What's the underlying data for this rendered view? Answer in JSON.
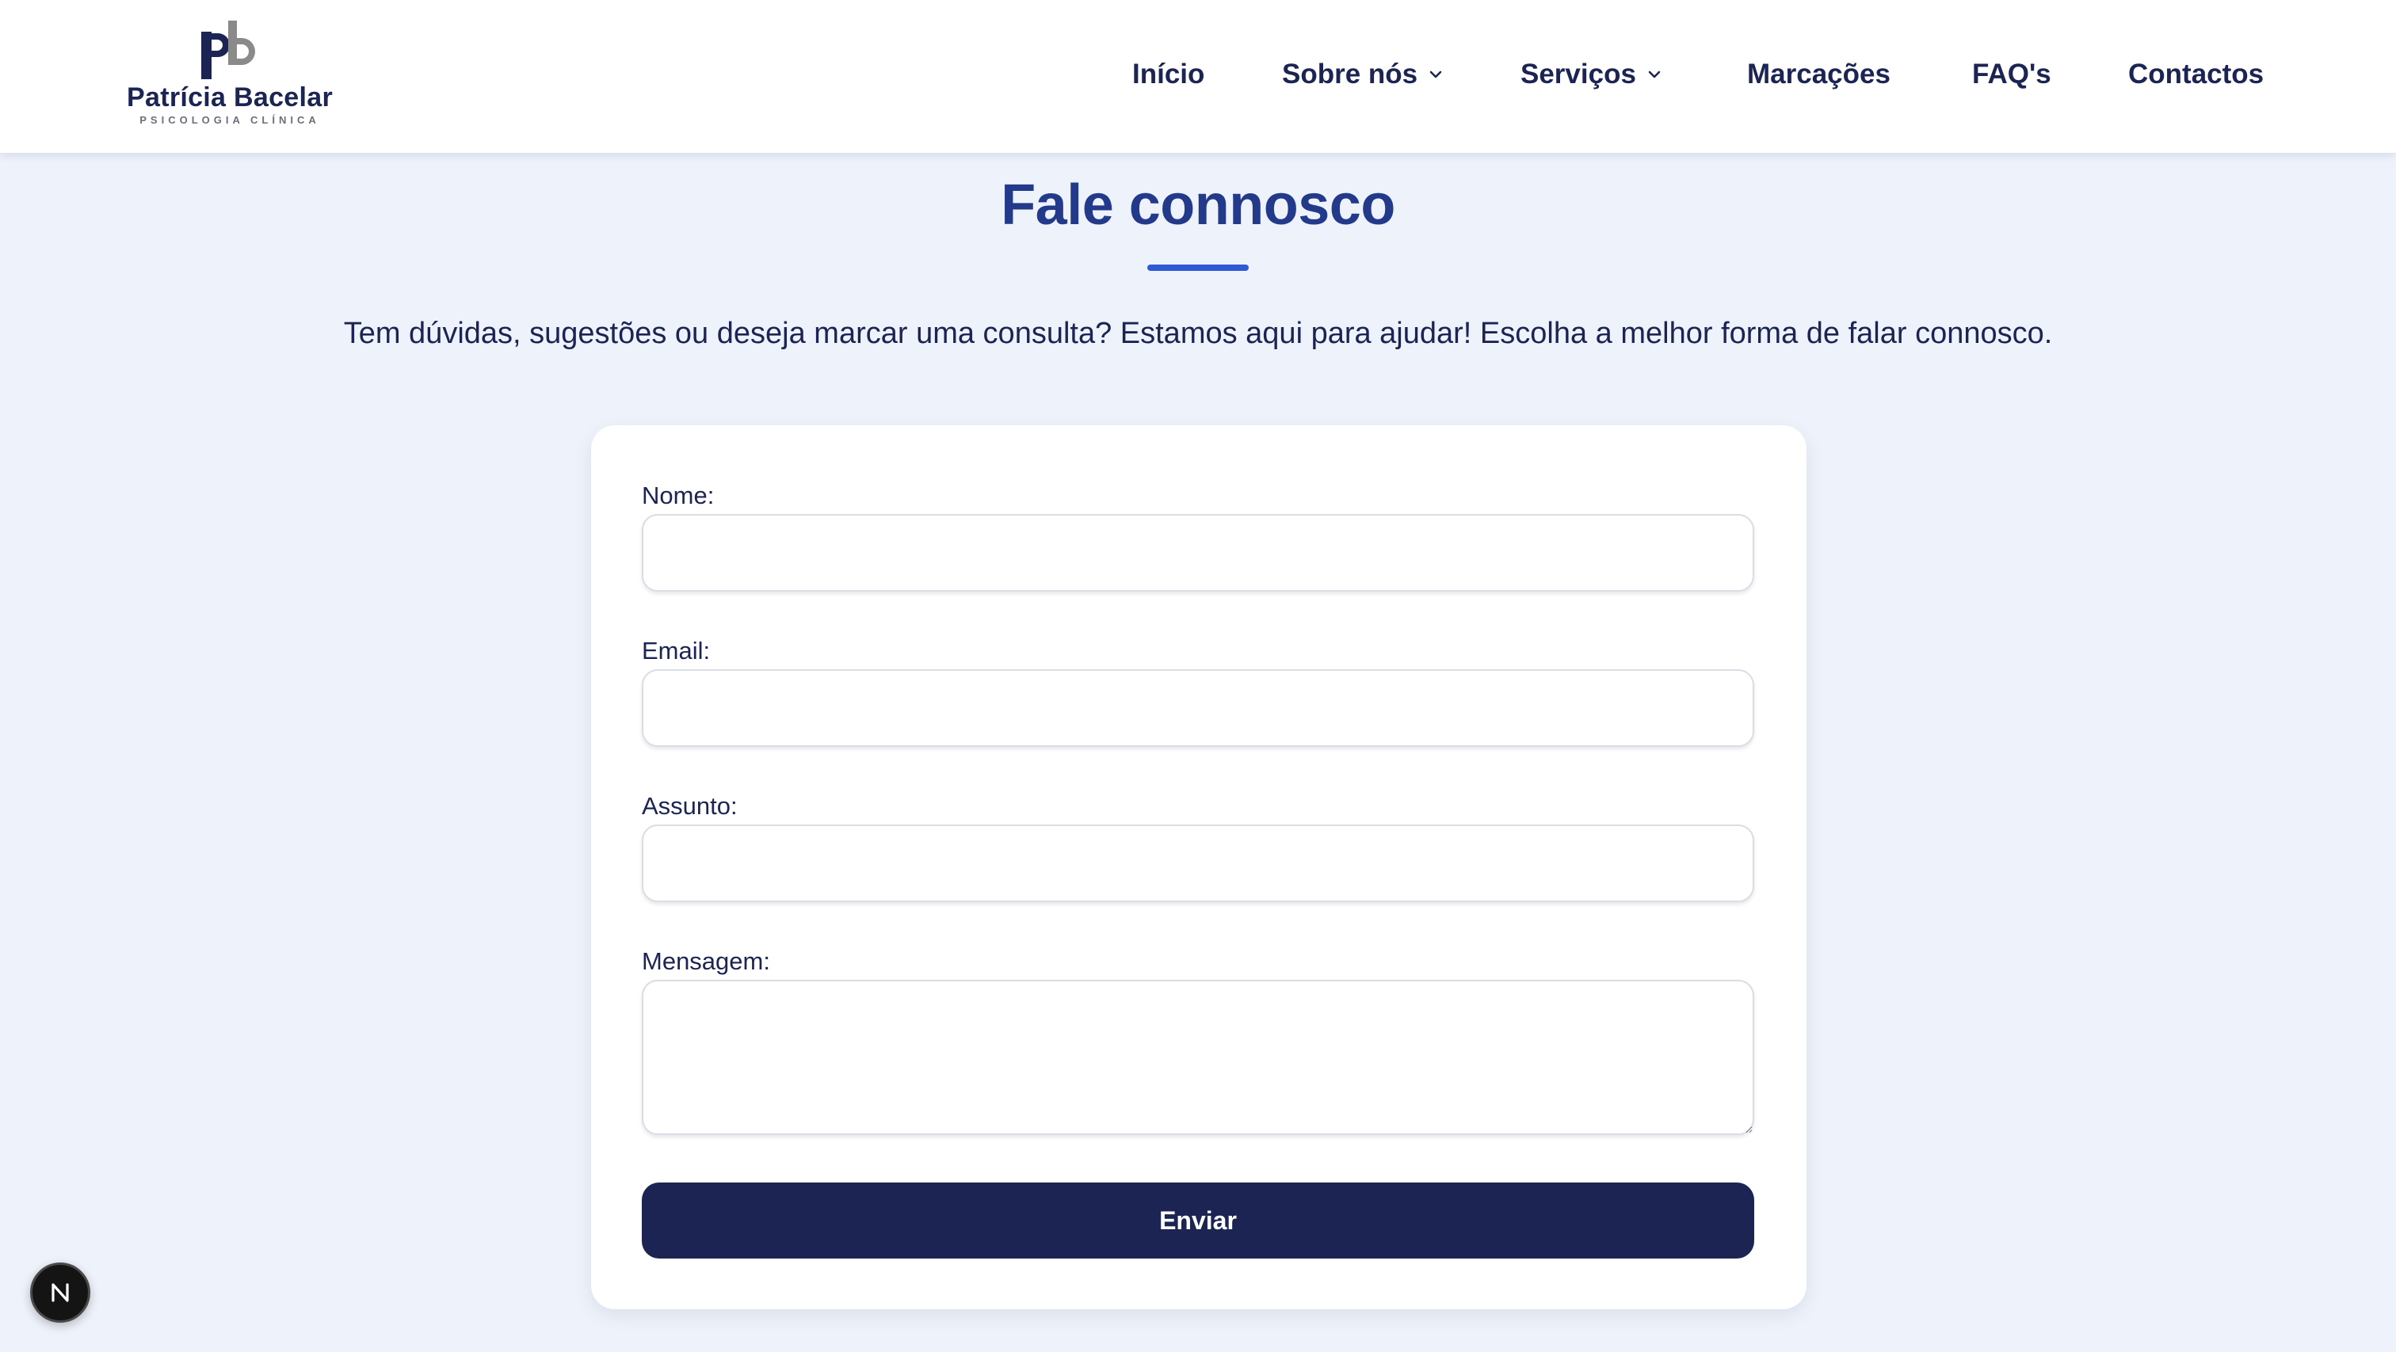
{
  "header": {
    "logo": {
      "name": "Patrícia Bacelar",
      "subtitle": "PSICOLOGIA CLÍNICA"
    },
    "nav": [
      {
        "label": "Início",
        "has_dropdown": false
      },
      {
        "label": "Sobre nós",
        "has_dropdown": true
      },
      {
        "label": "Serviços",
        "has_dropdown": true
      },
      {
        "label": "Marcações",
        "has_dropdown": false
      },
      {
        "label": "FAQ's",
        "has_dropdown": false
      },
      {
        "label": "Contactos",
        "has_dropdown": false
      }
    ]
  },
  "main": {
    "title": "Fale connosco",
    "intro": "Tem dúvidas, sugestões ou deseja marcar uma consulta? Estamos aqui para ajudar! Escolha a melhor forma de falar connosco.",
    "form": {
      "name_label": "Nome:",
      "name_value": "",
      "email_label": "Email:",
      "email_value": "",
      "subject_label": "Assunto:",
      "subject_value": "",
      "message_label": "Mensagem:",
      "message_value": "",
      "submit_label": "Enviar"
    }
  },
  "dev_badge": {
    "letter": "N"
  },
  "colors": {
    "brand_navy": "#1b2452",
    "title_blue": "#233a8b",
    "accent_blue": "#2f5ad6",
    "page_bg": "#eef3fb",
    "logo_gray": "#8a8a8a"
  }
}
